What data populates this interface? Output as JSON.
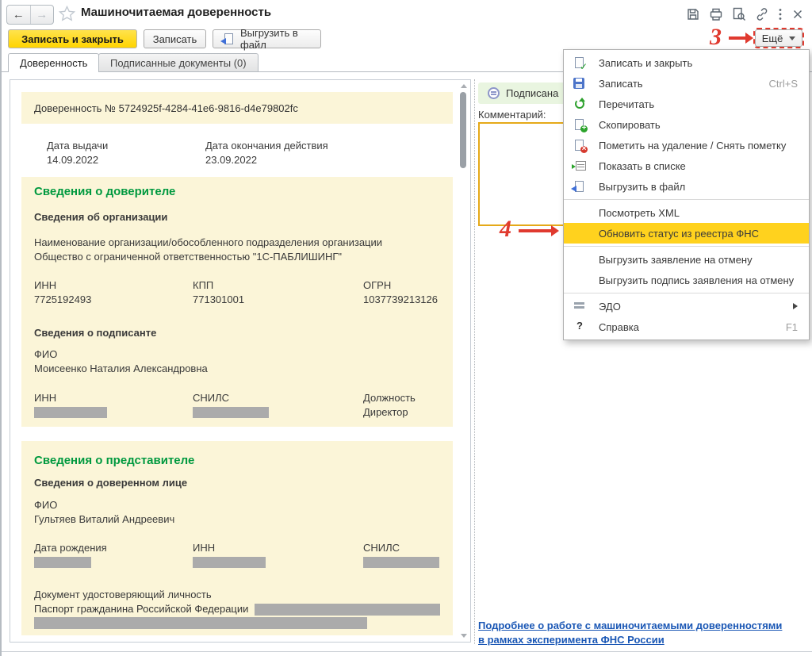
{
  "header": {
    "title": "Машиночитаемая доверенность",
    "window_icons": [
      "save-icon",
      "print-icon",
      "preview-icon",
      "link-icon",
      "more-dots-icon",
      "close-icon"
    ]
  },
  "toolbar": {
    "save_close_label": "Записать и закрыть",
    "save_label": "Записать",
    "export_label": "Выгрузить в файл",
    "more_label": "Ещё"
  },
  "tabs": [
    {
      "label": "Доверенность",
      "active": true
    },
    {
      "label": "Подписанные документы (0)",
      "active": false
    }
  ],
  "document": {
    "number_line": "Доверенность № 5724925f-4284-41e6-9816-d4e79802fc",
    "issue_date_label": "Дата выдачи",
    "issue_date": "14.09.2022",
    "expiry_label": "Дата окончания действия",
    "expiry_date": "23.09.2022",
    "principal": {
      "heading": "Сведения о доверителе",
      "org_heading": "Сведения об организации",
      "org_name_label": "Наименование организации/обособленного подразделения организации",
      "org_name": "Общество с ограниченной ответственностью \"1С-ПАБЛИШИНГ\"",
      "inn_label": "ИНН",
      "inn": "7725192493",
      "kpp_label": "КПП",
      "kpp": "771301001",
      "ogrn_label": "ОГРН",
      "ogrn": "1037739213126",
      "signer_heading": "Сведения о подписанте",
      "fio_label": "ФИО",
      "fio": "Моисеенко Наталия Александровна",
      "inn2_label": "ИНН",
      "snils_label": "СНИЛС",
      "position_label": "Должность",
      "position": "Директор"
    },
    "representative": {
      "heading": "Сведения о представителе",
      "person_heading": "Сведения о доверенном лице",
      "fio_label": "ФИО",
      "fio": "Гультяев Виталий Андреевич",
      "birth_label": "Дата рождения",
      "inn_label": "ИНН",
      "snils_label": "СНИЛС",
      "id_doc_label": "Документ удостоверяющий личность",
      "id_doc_value": "Паспорт гражданина Российской Федерации"
    }
  },
  "side_panel": {
    "status_label": "Подписана",
    "comment_label": "Комментарий:",
    "comment_value": "",
    "link_line1": "Подробнее о работе с машиночитаемыми доверенностями",
    "link_line2": "в рамках эксперимента ФНС России"
  },
  "menu": {
    "items": [
      {
        "label": "Записать и закрыть",
        "icon": "save-close-icon"
      },
      {
        "label": "Записать",
        "icon": "save-icon",
        "shortcut": "Ctrl+S"
      },
      {
        "label": "Перечитать",
        "icon": "refresh-icon"
      },
      {
        "label": "Скопировать",
        "icon": "copy-icon"
      },
      {
        "label": "Пометить на удаление / Снять пометку",
        "icon": "delete-mark-icon"
      },
      {
        "label": "Показать в списке",
        "icon": "show-in-list-icon"
      },
      {
        "label": "Выгрузить в файл",
        "icon": "export-file-icon"
      },
      {
        "separator": true
      },
      {
        "label": "Посмотреть XML"
      },
      {
        "label": "Обновить статус из реестра ФНС",
        "highlighted": true
      },
      {
        "separator": true
      },
      {
        "label": "Выгрузить заявление на отмену"
      },
      {
        "label": "Выгрузить подпись заявления на отмену"
      },
      {
        "separator": true
      },
      {
        "label": "ЭДО",
        "icon": "edo-icon",
        "submenu": true
      },
      {
        "label": "Справка",
        "icon": "help-icon",
        "shortcut": "F1"
      }
    ]
  },
  "annotations": {
    "step3": "3",
    "step4": "4"
  },
  "colors": {
    "menu_highlight": "#ffd21e",
    "primary_button_yellow": "#ffd400",
    "annotation_red": "#e03a2f",
    "document_pale_yellow": "#fbf5d8",
    "section_heading_green": "#00993f",
    "link_blue": "#1a57b5",
    "status_badge_green": "#e9f5e0",
    "comment_border_gold": "#e5a918",
    "redacted_gray": "#ababab"
  }
}
